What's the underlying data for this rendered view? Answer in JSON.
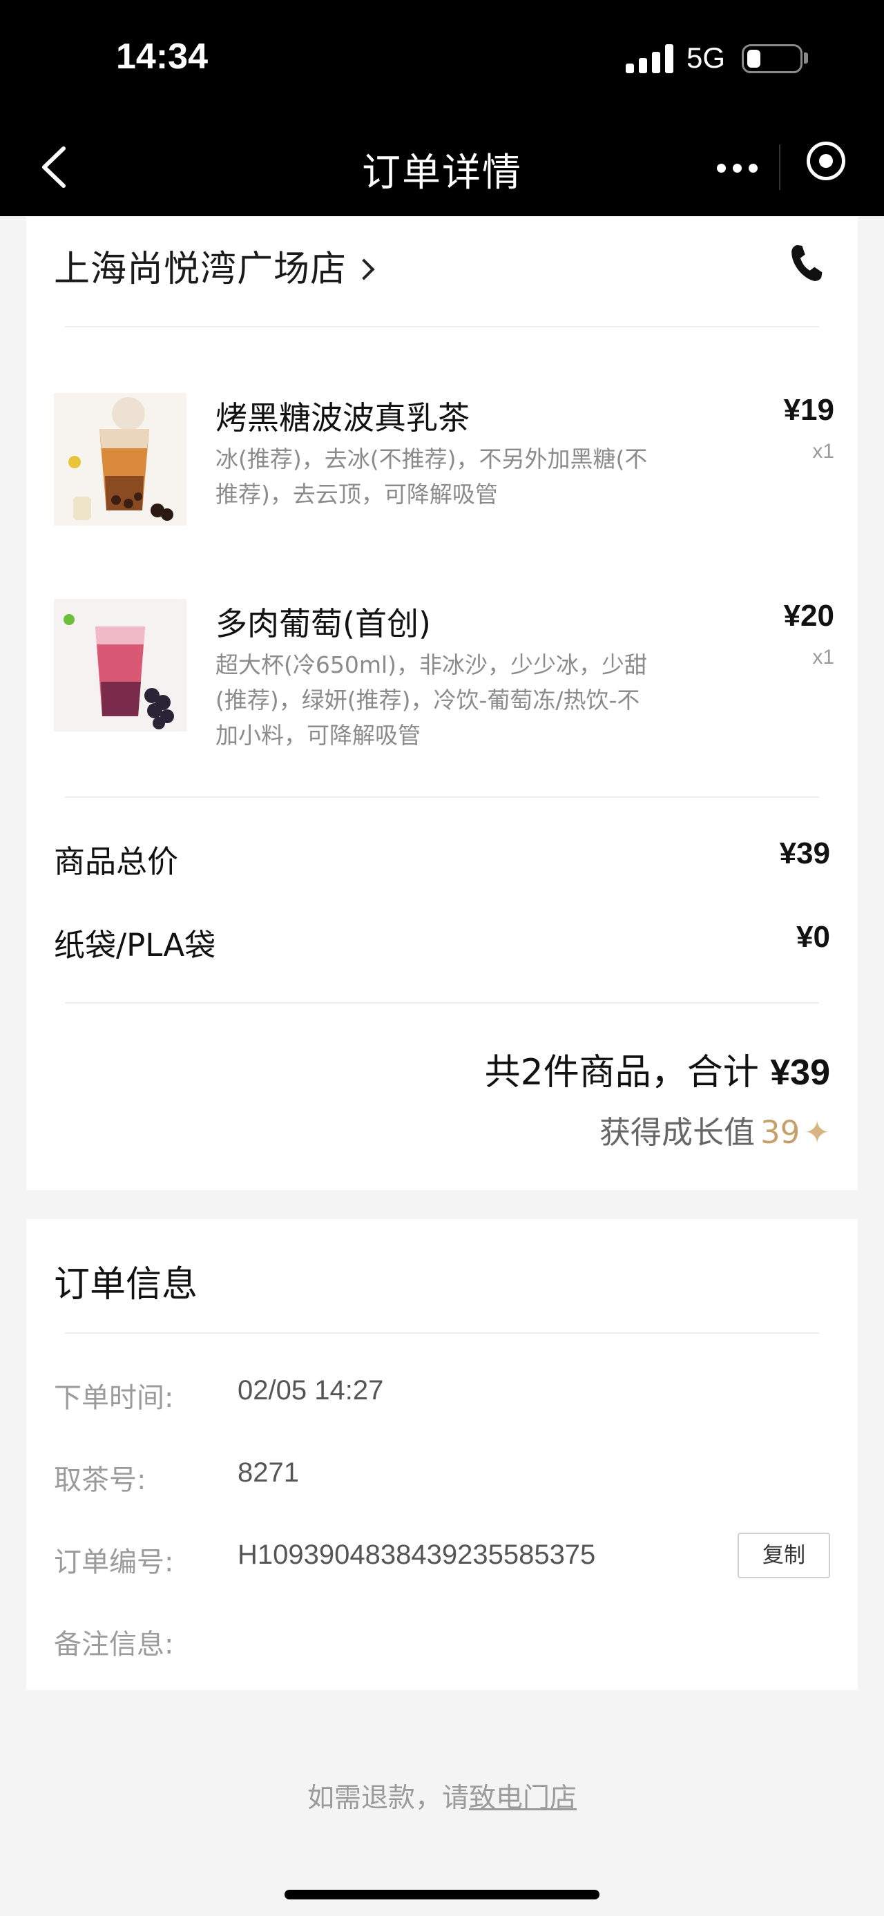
{
  "status_bar": {
    "time": "14:34",
    "network": "5G",
    "battery_level": 0.25
  },
  "nav": {
    "title": "订单详情",
    "icons": [
      "back-icon",
      "more-icon",
      "target-icon"
    ]
  },
  "store": {
    "name": "上海尚悦湾广场店",
    "icons": [
      "chevron-right-icon",
      "phone-icon"
    ]
  },
  "products": [
    {
      "name": "烤黑糖波波真乳茶",
      "spec_lines": [
        "冰(推荐)，去冰(不推荐)，不另外加黑糖(不",
        "推荐)，去云顶，可降解吸管"
      ],
      "price": "¥19",
      "qty": "x1"
    },
    {
      "name": "多肉葡萄(首创)",
      "spec_lines": [
        "超大杯(冷650ml)，非冰沙，少少冰，少甜",
        "(推荐)，绿妍(推荐)，冷饮-葡萄冻/热饮-不",
        "加小料，可降解吸管"
      ],
      "price": "¥20",
      "qty": "x1"
    }
  ],
  "summary": {
    "goods_total_label": "商品总价",
    "goods_total_value": "¥39",
    "bag_label": "纸袋/PLA袋",
    "bag_value": "¥0",
    "total_text": "共2件商品，合计",
    "total_amount": "¥39",
    "growth_label": "获得成长值",
    "growth_value": "39",
    "growth_icon": "sparkle-icon"
  },
  "order_info": {
    "title": "订单信息",
    "rows": [
      {
        "label": "下单时间:",
        "value": "02/05 14:27"
      },
      {
        "label": "取茶号:",
        "value": "8271"
      },
      {
        "label": "订单编号:",
        "value": "H1093904838439235585375"
      },
      {
        "label": "备注信息:",
        "value": ""
      }
    ],
    "copy_label": "复制"
  },
  "footer": {
    "refund_prefix": "如需退款，请",
    "refund_link": "致电门店"
  },
  "colors": {
    "accent_gold": "#c6a06a",
    "background": "#f4f4f4",
    "muted_text": "#9b9b9b"
  }
}
